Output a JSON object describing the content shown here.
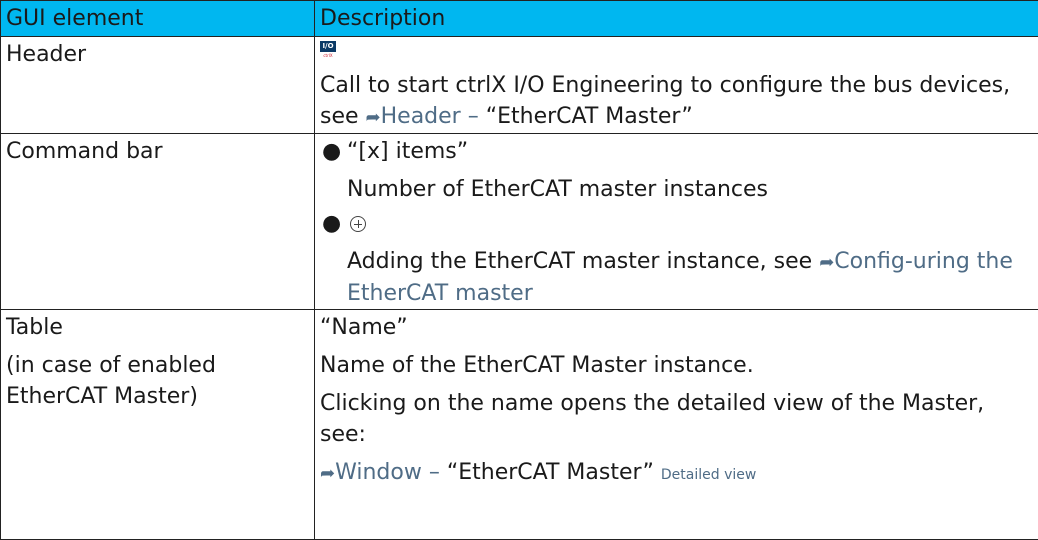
{
  "table": {
    "headers": [
      "GUI element",
      "Description"
    ],
    "header_bg": "#00b7f0",
    "link_color": "#4f6c86",
    "rows": [
      {
        "element": "Header",
        "icon": {
          "name": "io-engineering-icon",
          "top_text": "I/O",
          "bottom_text": "ctrlX"
        },
        "desc_text": "Call to start ctrlX I/O Engineering to configure the bus devices, see ",
        "link": "Header – ",
        "after_link": "“EtherCAT Master”"
      },
      {
        "element": "Command bar",
        "items": [
          {
            "title": "“[x] items”",
            "detail": "Number of EtherCAT master instances"
          },
          {
            "icon": "add-circle-icon",
            "detail_prefix": "Adding the EtherCAT master instance, see ",
            "link": "Config-uring the EtherCAT master"
          }
        ]
      },
      {
        "element": "Table",
        "element_note": "(in case of enabled EtherCAT Master)",
        "lines": [
          "“Name”",
          "Name of the EtherCAT Master instance.",
          "Clicking on the name opens the detailed view of the Master, see:"
        ],
        "link": "Window – ",
        "after_link": "“EtherCAT Master”",
        "link_suffix": "Detailed view"
      }
    ]
  }
}
